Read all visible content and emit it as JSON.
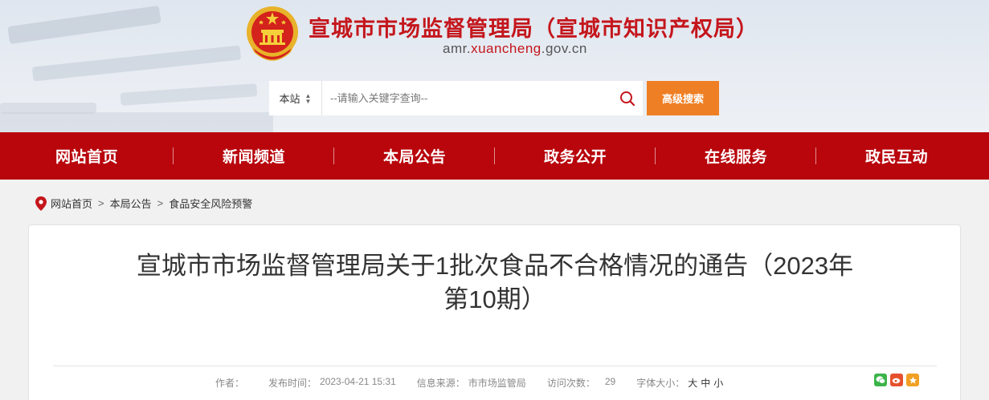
{
  "header": {
    "title": "宣城市市场监督管理局（宣城市知识产权局）",
    "url_prefix": "amr.",
    "url_highlight": "xuancheng",
    "url_suffix": ".gov.cn",
    "emblem_icon": "national-emblem-icon"
  },
  "search": {
    "scope_label": "本站",
    "placeholder": "--请输入关键字查询--",
    "search_icon": "search-icon",
    "advanced_label": "高级搜索"
  },
  "nav": {
    "items": [
      {
        "label": "网站首页"
      },
      {
        "label": "新闻频道"
      },
      {
        "label": "本局公告"
      },
      {
        "label": "政务公开"
      },
      {
        "label": "在线服务"
      },
      {
        "label": "政民互动"
      }
    ]
  },
  "breadcrumb": {
    "icon": "location-pin-icon",
    "items": [
      {
        "label": "网站首页"
      },
      {
        "label": "本局公告"
      },
      {
        "label": "食品安全风险预警"
      }
    ],
    "separator": ">"
  },
  "article": {
    "title_line1": "宣城市市场监督管理局关于1批次食品不合格情况的通告（2023年",
    "title_line2": "第10期）",
    "meta": {
      "author_label": "作者：",
      "author": "",
      "date_label": "发布时间：",
      "date": "2023-04-21 15:31",
      "source_label": "信息来源：",
      "source": "市市场监管局",
      "views_label": "访问次数：",
      "views": "29",
      "font_label": "字体大小：",
      "font_large": "大",
      "font_medium": "中",
      "font_small": "小"
    },
    "share_icons": [
      "wechat-icon",
      "weibo-icon",
      "favorite-icon"
    ]
  },
  "colors": {
    "brand_red": "#b8060c",
    "title_red": "#c4161c",
    "accent_orange": "#ef7f24"
  }
}
